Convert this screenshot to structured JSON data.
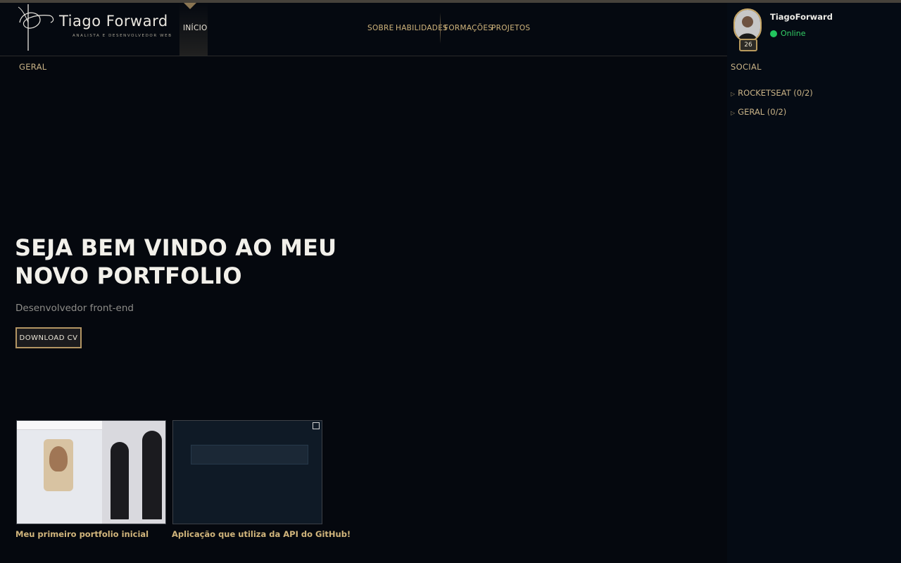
{
  "brand": {
    "name": "Tiago Forward",
    "tagline": "ANALISTA E DESENVOLVEDOR WEB"
  },
  "nav": {
    "active": "INÍCIO",
    "items": [
      "SOBRE",
      "HABILIDADES",
      "FORMAÇÕES",
      "PROJETOS"
    ]
  },
  "profile": {
    "username": "TiagoForward",
    "level": "26",
    "status": "Online"
  },
  "sections": {
    "left": "GERAL",
    "right": "SOCIAL"
  },
  "social": {
    "items": [
      "ROCKETSEAT (0/2)",
      "GERAL (0/2)"
    ]
  },
  "hero": {
    "title": "SEJA BEM VINDO AO MEU NOVO PORTFOLIO",
    "subtitle": "Desenvolvedor front-end",
    "button": "DOWNLOAD CV"
  },
  "projects": [
    {
      "caption": "Meu primeiro portfolio inicial"
    },
    {
      "caption": "Aplicação que utiliza da API do GitHub!"
    }
  ],
  "colors": {
    "accent": "#c9a866",
    "online": "#22c55e",
    "background": "#05080e"
  }
}
